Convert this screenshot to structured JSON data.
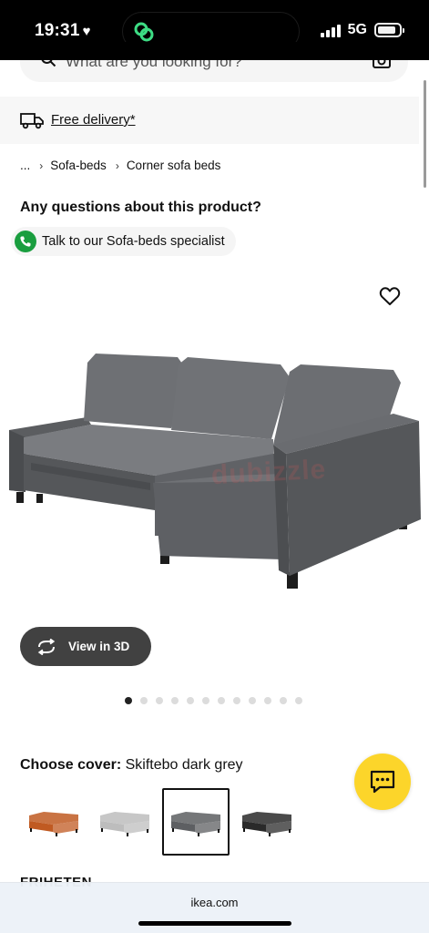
{
  "status_bar": {
    "time": "19:31",
    "heart": "♥",
    "network": "5G",
    "signal_bars": 4,
    "battery_level": 0.85
  },
  "search": {
    "placeholder": "What are you looking for?"
  },
  "delivery": {
    "label": "Free delivery*"
  },
  "breadcrumb": {
    "items": [
      "...",
      "Sofa-beds",
      "Corner sofa beds"
    ]
  },
  "questions": {
    "title": "Any questions about this product?",
    "specialist_label": "Talk to our Sofa-beds specialist"
  },
  "product": {
    "image_icon": "sofa-image",
    "watermark": "dubizzle",
    "view3d_label": "View in 3D"
  },
  "carousel": {
    "dot_count": 12,
    "active_index": 0
  },
  "cover": {
    "prefix": "Choose cover:",
    "selected": "Skiftebo dark grey",
    "swatches": [
      {
        "color": "#c05a22",
        "selected": false
      },
      {
        "color": "#bdbdbd",
        "selected": false
      },
      {
        "color": "#5d5f62",
        "selected": true
      },
      {
        "color": "#2a2a2a",
        "selected": false
      }
    ]
  },
  "next_section": {
    "title": "FRIHETEN"
  },
  "browser": {
    "url": "ikea.com"
  },
  "colors": {
    "accent_yellow": "#fcd52a",
    "phone_green": "#1a9e3f",
    "button_dark": "#414141"
  }
}
